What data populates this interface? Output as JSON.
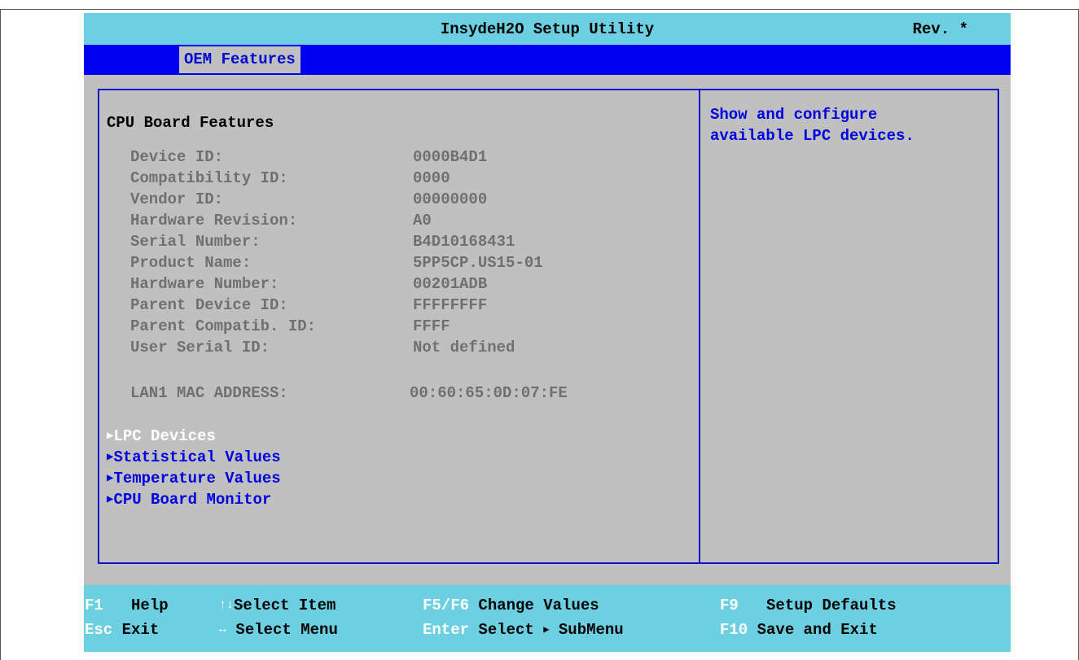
{
  "header": {
    "title": "InsydeH2O Setup Utility",
    "rev": "Rev. *"
  },
  "menu": {
    "active_tab": "OEM Features"
  },
  "main": {
    "section_title": "CPU Board Features",
    "info": [
      {
        "label": "Device ID:",
        "value": "0000B4D1"
      },
      {
        "label": "Compatibility ID:",
        "value": "0000"
      },
      {
        "label": "Vendor ID:",
        "value": "00000000"
      },
      {
        "label": "Hardware Revision:",
        "value": "A0"
      },
      {
        "label": "Serial Number:",
        "value": "B4D10168431"
      },
      {
        "label": "Product Name:",
        "value": "5PP5CP.US15-01"
      },
      {
        "label": "Hardware Number:",
        "value": "00201ADB"
      },
      {
        "label": "Parent Device ID:",
        "value": "FFFFFFFF"
      },
      {
        "label": "Parent Compatib. ID:",
        "value": "FFFF"
      },
      {
        "label": "User Serial ID:",
        "value": "Not defined"
      }
    ],
    "lan": {
      "label": "LAN1 MAC ADDRESS:",
      "value": "00:60:65:0D:07:FE"
    },
    "submenus": [
      {
        "label": "LPC Devices",
        "selected": true
      },
      {
        "label": "Statistical Values",
        "selected": false
      },
      {
        "label": "Temperature Values",
        "selected": false
      },
      {
        "label": "CPU Board Monitor",
        "selected": false
      }
    ]
  },
  "help": {
    "text": "Show and configure\navailable LPC devices."
  },
  "footer": {
    "f1_key": "F1",
    "f1_desc": "Help",
    "esc_key": "Esc",
    "esc_desc": "Exit",
    "updown_desc": "Select Item",
    "leftright_desc": "Select Menu",
    "f5f6_key": "F5/F6",
    "f5f6_desc": "Change Values",
    "enter_key": "Enter",
    "enter_desc_a": "Select",
    "enter_desc_b": "SubMenu",
    "f9_key": "F9",
    "f9_desc": "Setup Defaults",
    "f10_key": "F10",
    "f10_desc": "Save and Exit"
  },
  "icons": {
    "updown": "up-down-arrows-icon",
    "leftright": "left-right-arrow-icon",
    "submenu": "triangle-right-icon"
  },
  "colors": {
    "bar_cyan": "#6dd0e2",
    "menu_blue": "#0000f0",
    "panel_gray": "#c0c0c0",
    "text_blue": "#0000e0",
    "info_gray": "#707070"
  }
}
